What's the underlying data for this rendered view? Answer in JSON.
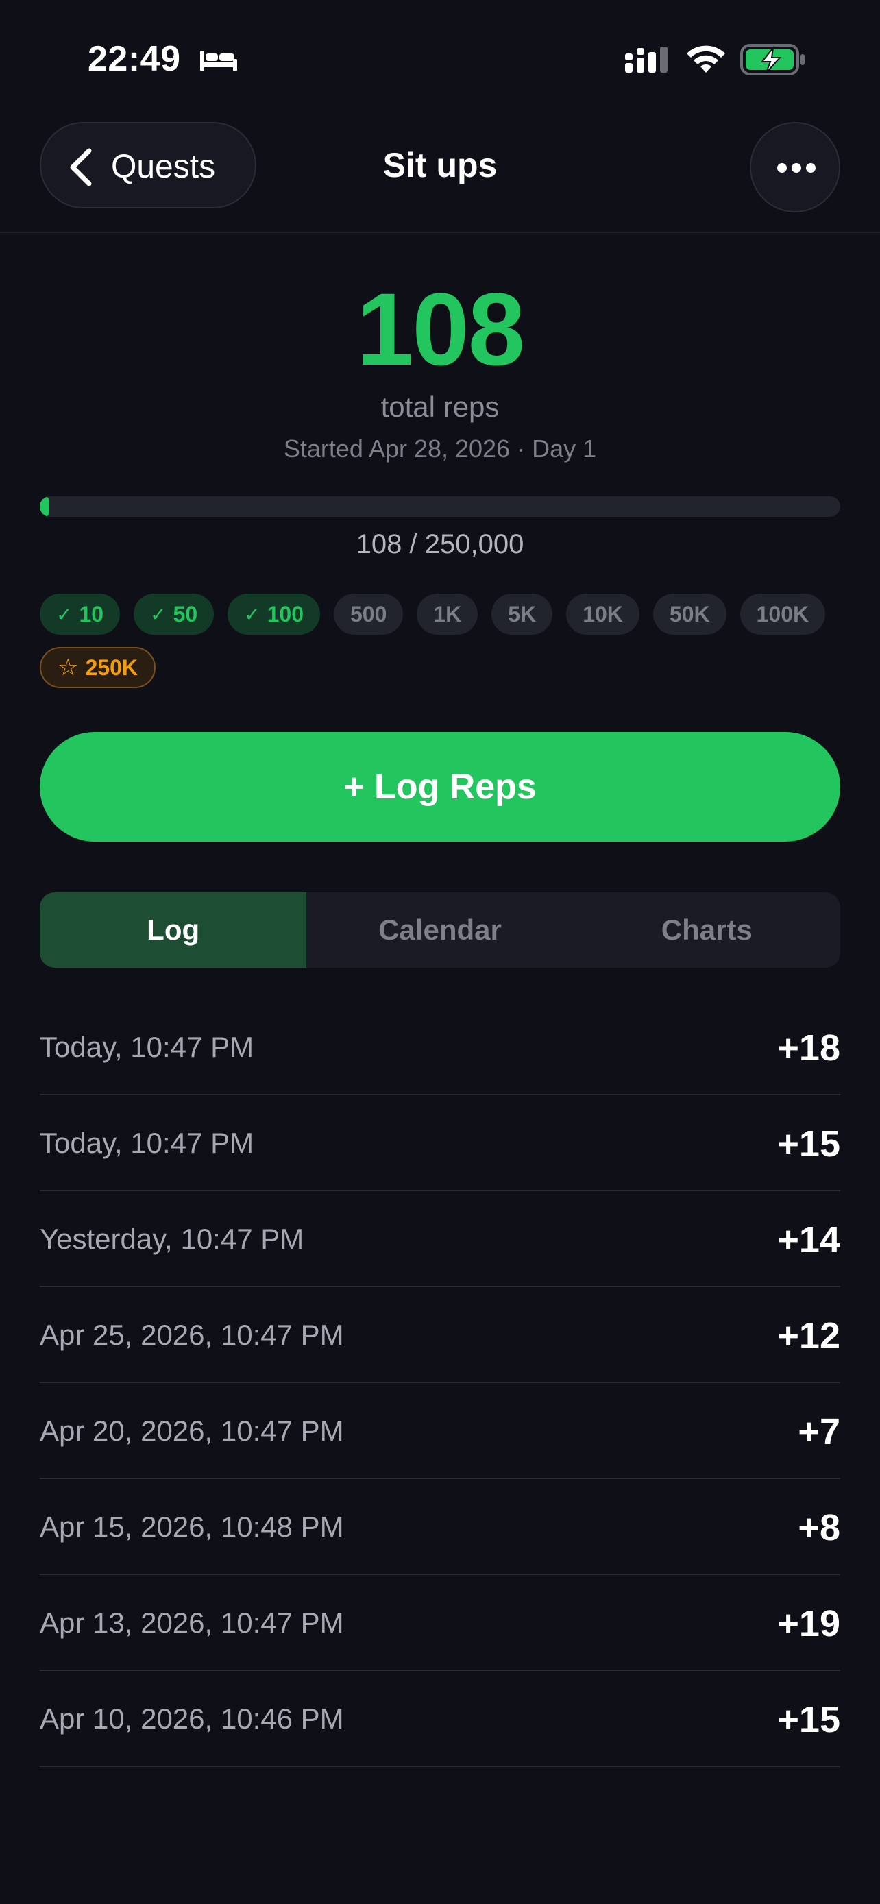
{
  "status_bar": {
    "time": "22:49",
    "icons": [
      "sleep-focus-icon",
      "cellular-signal-icon",
      "wifi-icon",
      "battery-charging-icon"
    ],
    "battery_color": "#22c55e"
  },
  "nav": {
    "back_label": "Quests",
    "title": "Sit ups",
    "more_icon": "ellipsis-icon"
  },
  "summary": {
    "total": "108",
    "total_label": "total reps",
    "started": "Started Apr 28, 2026 · Day 1",
    "progress_text": "108 / 250,000",
    "progress_fraction": 0.000432
  },
  "milestones": [
    {
      "label": "10",
      "state": "done",
      "mark": "✓"
    },
    {
      "label": "50",
      "state": "done",
      "mark": "✓"
    },
    {
      "label": "100",
      "state": "done",
      "mark": "✓"
    },
    {
      "label": "500",
      "state": "locked",
      "mark": ""
    },
    {
      "label": "1K",
      "state": "locked",
      "mark": ""
    },
    {
      "label": "5K",
      "state": "locked",
      "mark": ""
    },
    {
      "label": "10K",
      "state": "locked",
      "mark": ""
    },
    {
      "label": "50K",
      "state": "locked",
      "mark": ""
    },
    {
      "label": "100K",
      "state": "locked",
      "mark": ""
    },
    {
      "label": "250K",
      "state": "target",
      "mark": "☆"
    }
  ],
  "log_button": "+ Log Reps",
  "tabs": [
    {
      "label": "Log",
      "active": true
    },
    {
      "label": "Calendar",
      "active": false
    },
    {
      "label": "Charts",
      "active": false
    }
  ],
  "entries": [
    {
      "date": "Today, 10:47 PM",
      "amount": "+18"
    },
    {
      "date": "Today, 10:47 PM",
      "amount": "+15"
    },
    {
      "date": "Yesterday, 10:47 PM",
      "amount": "+14"
    },
    {
      "date": "Apr 25, 2026, 10:47 PM",
      "amount": "+12"
    },
    {
      "date": "Apr 20, 2026, 10:47 PM",
      "amount": "+7"
    },
    {
      "date": "Apr 15, 2026, 10:48 PM",
      "amount": "+8"
    },
    {
      "date": "Apr 13, 2026, 10:47 PM",
      "amount": "+19"
    },
    {
      "date": "Apr 10, 2026, 10:46 PM",
      "amount": "+15"
    }
  ],
  "colors": {
    "accent": "#22c55e",
    "background": "#0e0f17",
    "target": "#f59e0b"
  }
}
